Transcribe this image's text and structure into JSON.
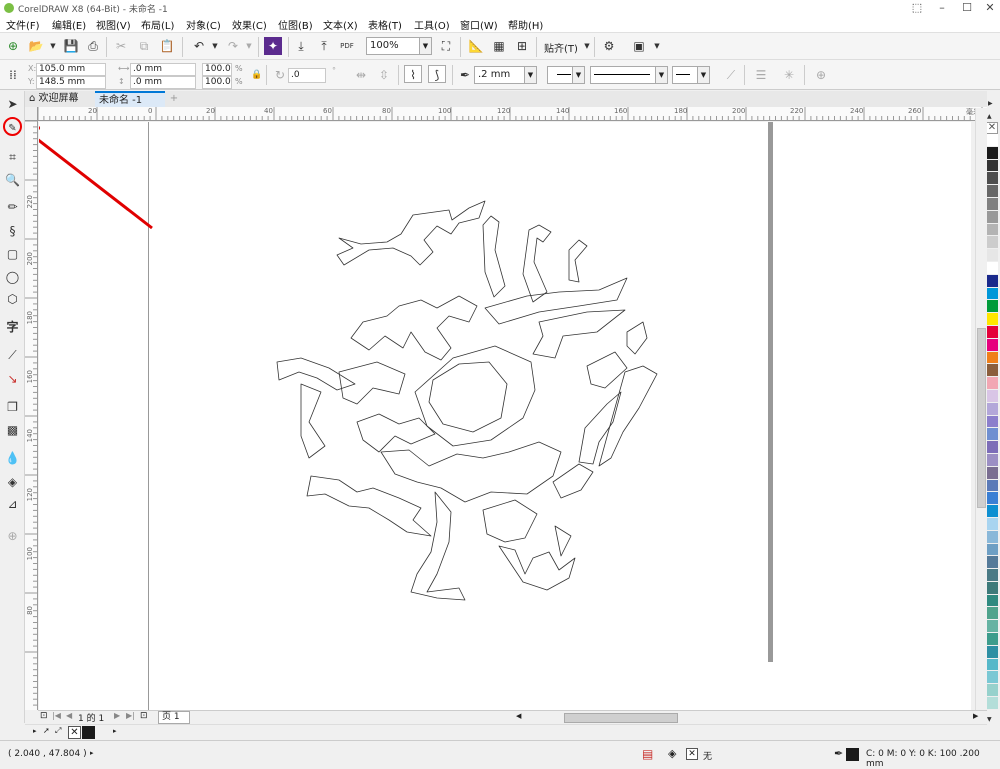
{
  "window": {
    "title": "CorelDRAW X8 (64-Bit) - 未命名 -1",
    "accent_color": "#0078d7"
  },
  "menu": [
    "文件(F)",
    "编辑(E)",
    "视图(V)",
    "布局(L)",
    "对象(C)",
    "效果(C)",
    "位图(B)",
    "文本(X)",
    "表格(T)",
    "工具(O)",
    "窗口(W)",
    "帮助(H)"
  ],
  "toolbar": {
    "zoom": "100%",
    "snap_label": "贴齐(T)",
    "pdf_label": "PDF"
  },
  "properties": {
    "x": "105.0 mm",
    "y": "148.5 mm",
    "width": ".0 mm",
    "height": ".0 mm",
    "scale_w": "100.0",
    "scale_h": "100.0",
    "percent": "%",
    "rotation": ".0",
    "outline_width": ".2 mm"
  },
  "tabs": {
    "welcome": "欢迎屏幕",
    "document": "未命名 -1"
  },
  "ruler": {
    "h_ticks": [
      "20",
      "0",
      "20",
      "40",
      "60",
      "80",
      "100",
      "120",
      "140",
      "160",
      "180",
      "200",
      "220",
      "240",
      "260"
    ],
    "v_ticks": [
      "220",
      "200",
      "180",
      "160",
      "140",
      "120",
      "100",
      "80"
    ],
    "units": "毫米"
  },
  "pagebar": {
    "page_counter": "1 的 1",
    "page_tab": "页 1"
  },
  "status": {
    "coordinates": "( 2.040 , 47.804 )",
    "fill_label": "无",
    "outline_info": "C: 0 M: 0 Y: 0 K: 100  .200 mm"
  },
  "palette": [
    "#ffffff",
    "#1a1a1a",
    "#333333",
    "#4d4d4d",
    "#666666",
    "#808080",
    "#999999",
    "#b3b3b3",
    "#cccccc",
    "#e6e6e6",
    "#ffffff",
    "#1b2a8c",
    "#0097d8",
    "#009b3a",
    "#ffe600",
    "#e4003a",
    "#e6007e",
    "#ef7f1a",
    "#8b5e3c",
    "#f2a7b3",
    "#d9c5e6",
    "#b3a7d9",
    "#8c7fcc",
    "#6f8fd1",
    "#7d6db8",
    "#9c8fc4",
    "#7a6e91",
    "#5a7ab8",
    "#3a7fd4",
    "#0d8fd1",
    "#a8d4f0",
    "#8ab8d9",
    "#6e9fc4",
    "#557a99",
    "#4a7a85",
    "#3d7a7a",
    "#2f8a80",
    "#4fa38c",
    "#66b3a3",
    "#3d9c8c",
    "#2e8fa3",
    "#56b8c9",
    "#7ac8d4",
    "#96d1cc",
    "#b3ded9"
  ]
}
